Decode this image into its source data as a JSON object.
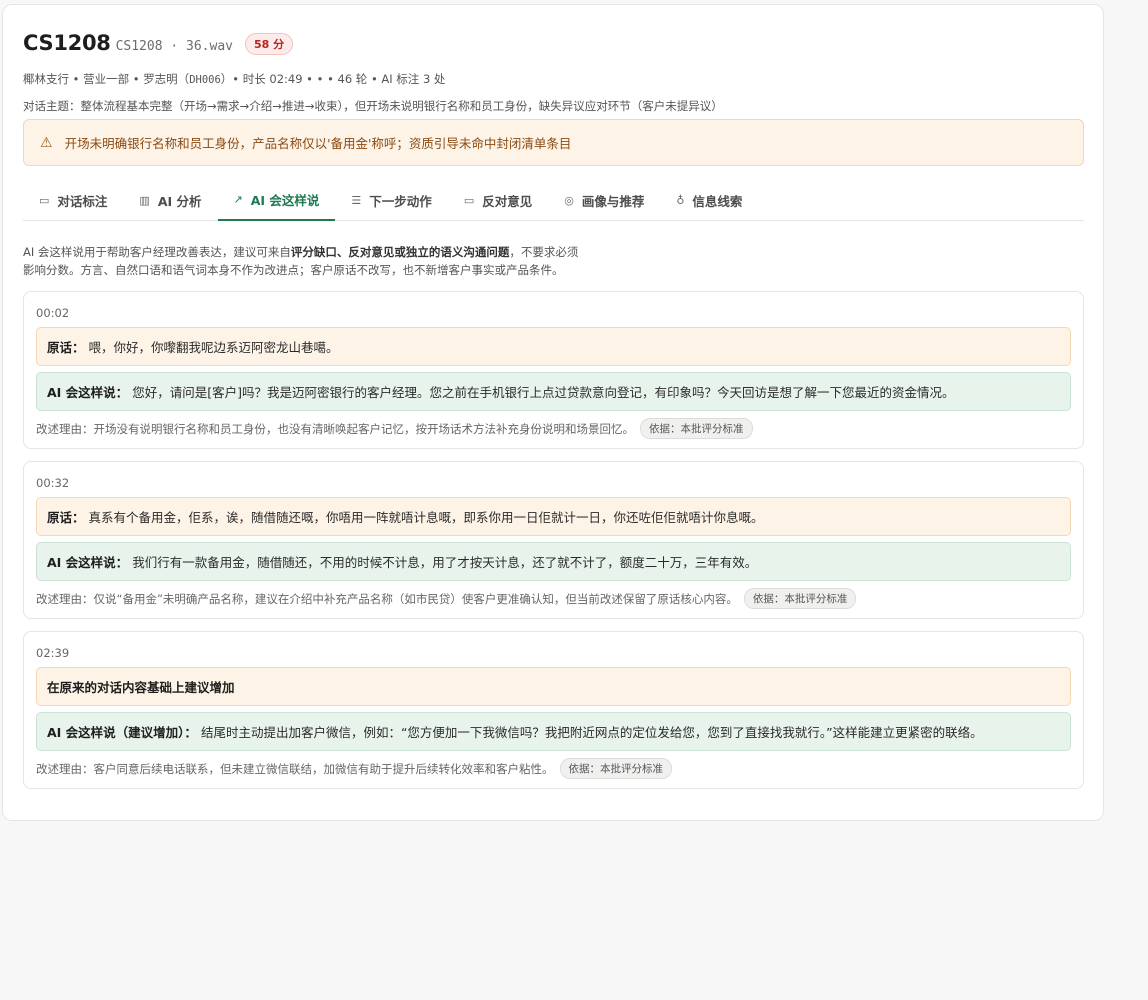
{
  "header": {
    "title": "CS1208",
    "subtitle": "CS1208 · 36.wav",
    "score": "58 分",
    "meta_pre": "椰林支行 • 营业一部 • 罗志明（",
    "meta_code": "DH006",
    "meta_post": "）• 时长 02:49 • • • 46 轮 • AI 标注 3 处",
    "topic": "对话主题：整体流程基本完整（开场→需求→介绍→推进→收束），但开场未说明银行名称和员工身份，缺失异议应对环节（客户未提异议）"
  },
  "alert": {
    "icon": "warning-icon",
    "text": "开场未明确银行名称和员工身份，产品名称仅以'备用金'称呼；资质引导未命中封闭清单条目"
  },
  "tabs": [
    {
      "label": "对话标注",
      "icon": "comment-icon"
    },
    {
      "label": "AI 分析",
      "icon": "bar-chart-icon"
    },
    {
      "label": "AI 会这样说",
      "icon": "magic-wand-icon"
    },
    {
      "label": "下一步动作",
      "icon": "checklist-icon"
    },
    {
      "label": "反对意见",
      "icon": "message-icon"
    },
    {
      "label": "画像与推荐",
      "icon": "target-icon"
    },
    {
      "label": "信息线索",
      "icon": "lightbulb-icon"
    }
  ],
  "intro": {
    "line1_pre": "AI 会这样说用于帮助客户经理改善表达，建议可来自",
    "line1_bold": "评分缺口、反对意见或独立的语义沟通问题",
    "line1_post": "，不要求必须",
    "line2": "影响分数。方言、自然口语和语气词本身不作为改进点；客户原话不改写，也不新增客户事实或产品条件。"
  },
  "suggestions": [
    {
      "time": "00:02",
      "orig_label": "原话：",
      "orig_text": "喂，你好，你嚟翻我呢边系迈阿密龙山巷噶。",
      "ai_label": "AI 会这样说：",
      "ai_text": "您好，请问是[客户]吗？我是迈阿密银行的客户经理。您之前在手机银行上点过贷款意向登记，有印象吗？今天回访是想了解一下您最近的资金情况。",
      "reason": "改述理由：开场没有说明银行名称和员工身份，也没有清晰唤起客户记忆，按开场话术方法补充身份说明和场景回忆。",
      "basis": "依据：本批评分标准"
    },
    {
      "time": "00:32",
      "orig_label": "原话：",
      "orig_text": "真系有个备用金，佢系，诶，随借随还嘅，你唔用一阵就唔计息嘅，即系你用一日佢就计一日，你还咗佢佢就唔计你息嘅。",
      "ai_label": "AI 会这样说：",
      "ai_text": "我们行有一款备用金，随借随还，不用的时候不计息，用了才按天计息，还了就不计了，额度二十万，三年有效。",
      "reason": "改述理由：仅说“备用金”未明确产品名称，建议在介绍中补充产品名称（如市民贷）使客户更准确认知，但当前改述保留了原话核心内容。",
      "basis": "依据：本批评分标准"
    },
    {
      "time": "02:39",
      "orig_label": "在原来的对话内容基础上建议增加",
      "orig_text": "",
      "ai_label": "AI 会这样说（建议增加）：",
      "ai_text": "结尾时主动提出加客户微信，例如：“您方便加一下我微信吗？我把附近网点的定位发给您，您到了直接找我就行。”这样能建立更紧密的联络。",
      "reason": "改述理由：客户同意后续电话联系，但未建立微信联结，加微信有助于提升后续转化效率和客户粘性。",
      "basis": "依据：本批评分标准"
    }
  ]
}
